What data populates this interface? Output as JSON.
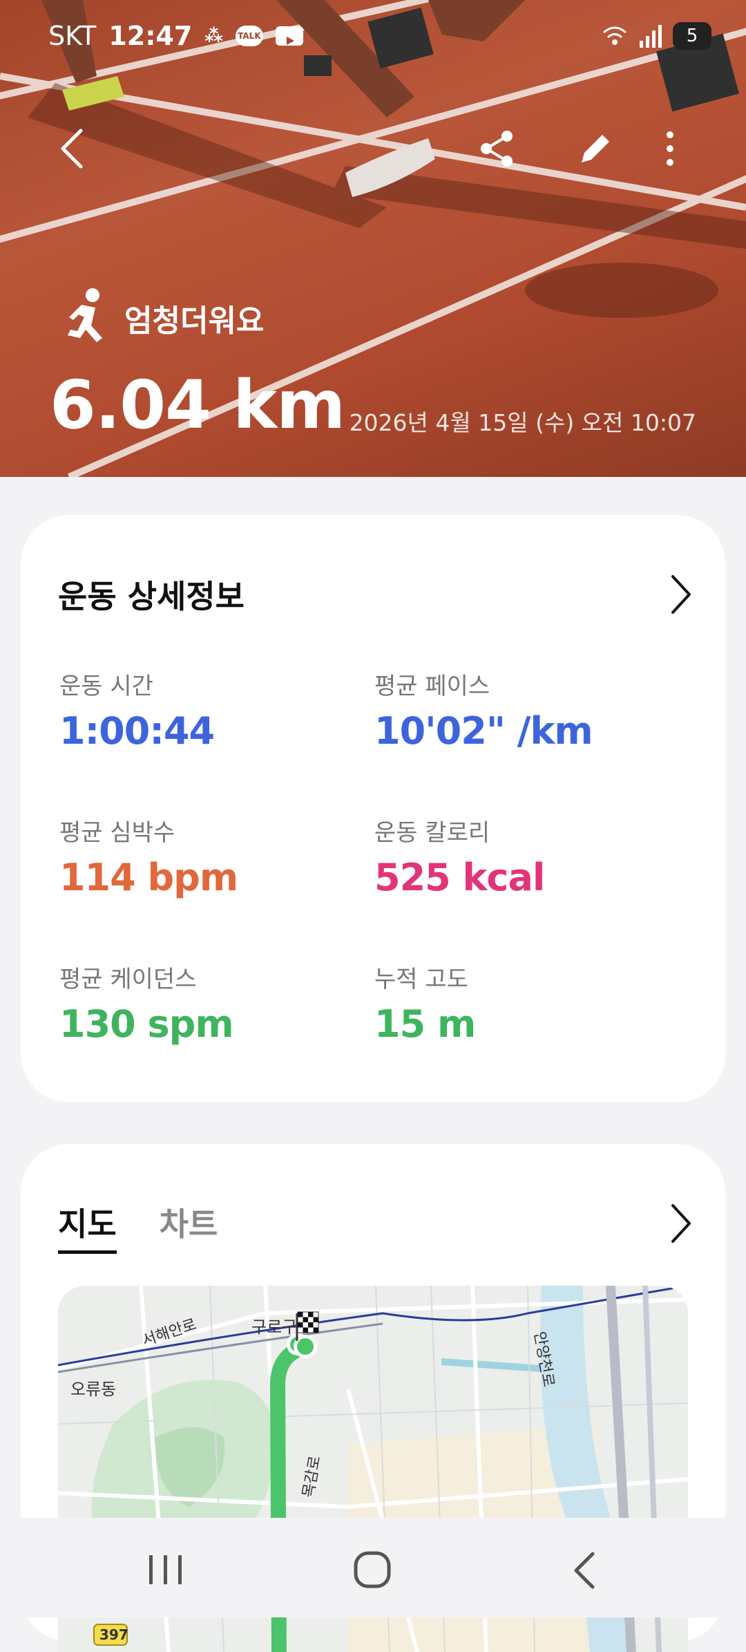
{
  "status_bar": {
    "carrier": "SKT",
    "time": "12:47",
    "battery_level": "5"
  },
  "header": {
    "activity_label": "엄청더워요",
    "distance": "6.04 km",
    "datetime": "2026년 4월 15일 (수) 오전 10:07"
  },
  "details": {
    "title": "운동 상세정보",
    "metrics": [
      {
        "label": "운동 시간",
        "value": "1:00:44",
        "color": "#3c64dc"
      },
      {
        "label": "평균 페이스",
        "value": "10'02\" /km",
        "color": "#3c64dc"
      },
      {
        "label": "평균 심박수",
        "value": "114 bpm",
        "color": "#e0683c"
      },
      {
        "label": "운동 칼로리",
        "value": "525 kcal",
        "color": "#e0357a"
      },
      {
        "label": "평균 케이던스",
        "value": "130 spm",
        "color": "#3fb45e"
      },
      {
        "label": "누적 고도",
        "value": "15 m",
        "color": "#3fb45e"
      }
    ]
  },
  "map_section": {
    "tabs": [
      {
        "label": "지도",
        "active": true
      },
      {
        "label": "차트",
        "active": false
      }
    ],
    "map_labels": {
      "district": "구로구",
      "road1": "서해안로",
      "area": "오류동",
      "river": "안양천로",
      "road2": "목감로",
      "route_number": "397"
    },
    "route_color": "#4cc46a"
  },
  "icons": {
    "back": "back-arrow-icon",
    "share": "share-icon",
    "edit": "pencil-icon",
    "more": "more-vertical-icon",
    "runner": "running-person-icon"
  }
}
